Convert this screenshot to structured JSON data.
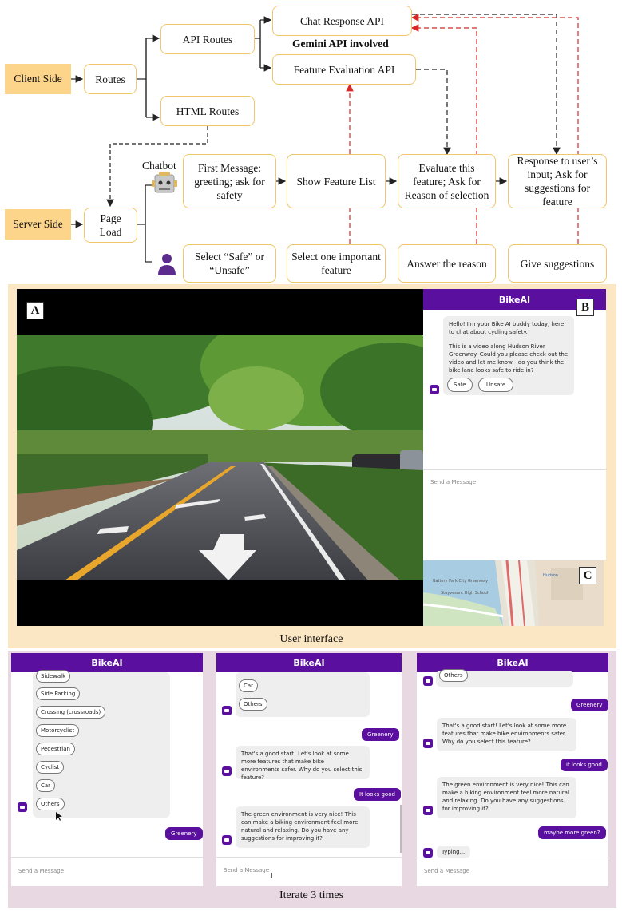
{
  "diagram": {
    "client_side": "Client Side",
    "server_side": "Server Side",
    "routes": "Routes",
    "api_routes": "API Routes",
    "html_routes": "HTML Routes",
    "chat_response_api": "Chat Response API",
    "feature_evaluation_api": "Feature Evaluation API",
    "gemini_note": "Gemini API involved",
    "page_load": "Page Load",
    "chatbot_label": "Chatbot",
    "first_message": "First Message: greeting; ask for safety",
    "show_feature_list": "Show Feature List",
    "evaluate_feature": "Evaluate this feature; Ask for Reason of selection",
    "response_input": "Response to user’s input; Ask for suggestions for feature",
    "select_safe": "Select “Safe” or “Unsafe”",
    "select_feature": "Select one important feature",
    "answer_reason": "Answer the reason",
    "give_suggestions": "Give suggestions",
    "colors": {
      "box_border": "#f2c66a",
      "side_fill": "#fcd58b",
      "red_dash": "#d62828",
      "black_dash": "#222222",
      "user_icon": "#5b2c8e"
    }
  },
  "ui": {
    "label_a": "A",
    "label_b": "B",
    "label_c": "C",
    "app_title": "BikeAI",
    "welcome_1": "Hello! I'm your Bike AI buddy today, here to chat about cycling safety.",
    "welcome_2": "This is a video along Hudson River Greenway. Could you please check out the video and let me know - do you think the bike lane looks safe to ride in?",
    "safe_button": "Safe",
    "unsafe_button": "Unsafe",
    "input_placeholder": "Send a Message",
    "caption": "User interface",
    "map_labels": {
      "park": "Battery Park City Greenway",
      "school": "Stuyvesant High School",
      "hs": "Hudson"
    }
  },
  "iterations": {
    "caption": "Iterate 3 times",
    "panel1": {
      "title": "BikeAI",
      "options": [
        "Sidewalk",
        "Side Parking",
        "Crossing (crossroads)",
        "Motorcyclist",
        "Pedestrian",
        "Cyclist",
        "Car",
        "Others"
      ],
      "user_msg": "Greenery",
      "input_placeholder": "Send a Message"
    },
    "panel2": {
      "title": "BikeAI",
      "options": [
        "Car",
        "Others"
      ],
      "user_msg_1": "Greenery",
      "bot_msg_1": "That's a good start! Let's look at some more features that make bike environments safer. Why do you select this feature?",
      "user_msg_2": "It looks good",
      "bot_msg_2": "The green environment is very nice! This can make a biking environment feel more natural and relaxing. Do you have any suggestions for improving it?",
      "input_placeholder": "Send a Message"
    },
    "panel3": {
      "title": "BikeAI",
      "top_option": "Others",
      "user_msg_1": "Greenery",
      "bot_msg_1": "That's a good start! Let's look at some more features that make bike environments safer. Why do you select this feature?",
      "user_msg_2": "it looks good",
      "bot_msg_2": "The green environment is very nice! This can make a biking environment feel more natural and relaxing. Do you have any suggestions for improving it?",
      "user_msg_3": "maybe more green?",
      "typing": "Typing...",
      "input_placeholder": "Send a Message"
    }
  }
}
